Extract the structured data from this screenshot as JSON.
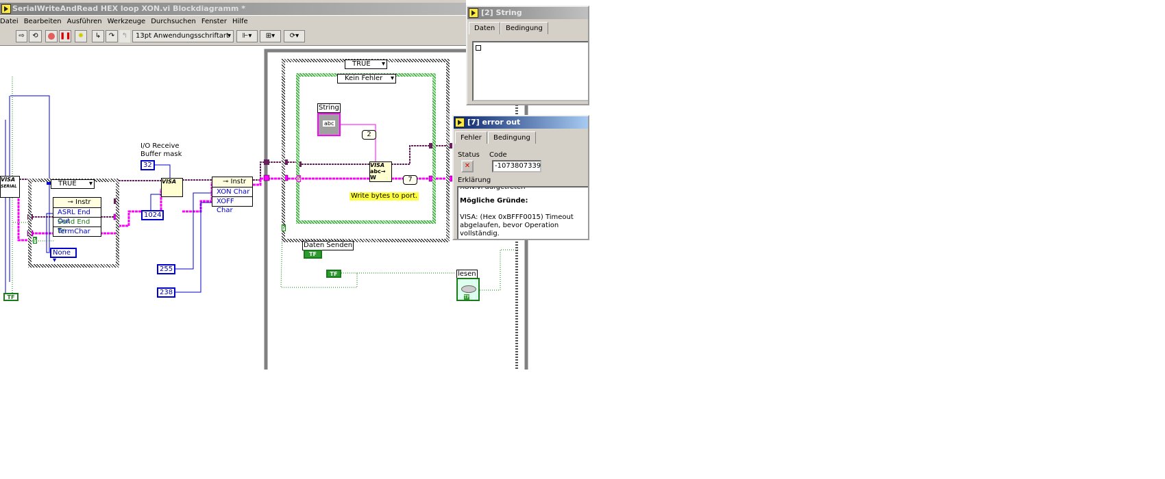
{
  "window": {
    "title": "SerialWriteAndRead HEX loop XON.vi Blockdiagramm *"
  },
  "menu": [
    "Datei",
    "Bearbeiten",
    "Ausführen",
    "Werkzeuge",
    "Durchsuchen",
    "Fenster",
    "Hilfe"
  ],
  "toolbar": {
    "font_select": "13pt Anwendungsschriftart"
  },
  "diagram": {
    "left_case_selector": "TRUE",
    "visa_serial_label": "VISA",
    "visa_serial_sub": "SERIAL",
    "prop1": {
      "header": "Instr",
      "items": [
        "ASRL End Out",
        "Send End En",
        "TermChar"
      ]
    },
    "enum_none": "None",
    "buffer_label": "I/O Receive Buffer mask",
    "const_32": "32",
    "const_1024": "1024",
    "visa_label": "VISA",
    "prop2": {
      "header": "Instr",
      "items": [
        "XON Char",
        "XOFF Char"
      ]
    },
    "const_255": "255",
    "const_238": "238",
    "outer_case_selector": "TRUE",
    "inner_case_selector": "Kein Fehler",
    "string_label": "String",
    "string_glyph": "abc",
    "const_2": "2",
    "const_7": "7",
    "write_label": "VISA",
    "comment": "Write bytes to port.",
    "daten_senden_label": "Daten Senden",
    "tf": "TF",
    "lesen_label": "lesen",
    "q": "?"
  },
  "probe_string": {
    "title": "[2] String",
    "tabs": [
      "Daten",
      "Bedingung"
    ]
  },
  "probe_error": {
    "title": "[7] error out",
    "tabs": [
      "Fehler",
      "Bedingung"
    ],
    "status_label": "Status",
    "code_label": "Code",
    "code_value": "-1073807339",
    "explain_label": "Erklärung",
    "explain_cut": "XON.vi aufgetreten",
    "reasons_heading": "Mögliche Gründe:",
    "reason_text": "VISA:  (Hex 0xBFFF0015) Timeout abgelaufen, bevor Operation vollständig."
  },
  "colors": {
    "error_wire": "#ff00ff",
    "visa_wire": "#6b1f5f",
    "numeric_wire": "#0000cc",
    "bool_wire": "#008000"
  }
}
